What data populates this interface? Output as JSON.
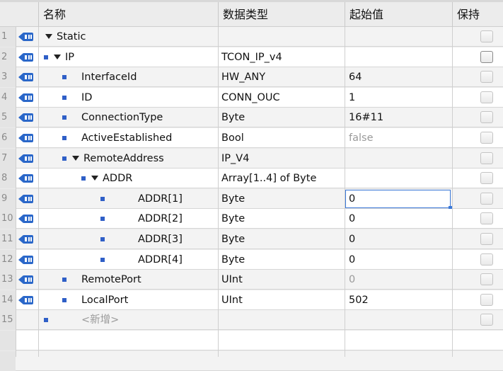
{
  "columns": {
    "name": "名称",
    "data_type": "数据类型",
    "start_value": "起始值",
    "retain": "保持"
  },
  "rows": [
    {
      "num": "1",
      "level": 0,
      "expander": true,
      "bullet": false,
      "name": "Static",
      "type": "",
      "value": "",
      "value_gray": false,
      "check_dark": false
    },
    {
      "num": "2",
      "level": 0,
      "expander": true,
      "bullet": true,
      "name": "IP",
      "type": "TCON_IP_v4",
      "value": "",
      "value_gray": false,
      "check_dark": true
    },
    {
      "num": "3",
      "level": 1,
      "expander": false,
      "bullet": true,
      "name": "InterfaceId",
      "type": "HW_ANY",
      "value": "64",
      "value_gray": false,
      "check_dark": false
    },
    {
      "num": "4",
      "level": 1,
      "expander": false,
      "bullet": true,
      "name": "ID",
      "type": "CONN_OUC",
      "value": "1",
      "value_gray": false,
      "check_dark": false
    },
    {
      "num": "5",
      "level": 1,
      "expander": false,
      "bullet": true,
      "name": "ConnectionType",
      "type": "Byte",
      "value": "16#11",
      "value_gray": false,
      "check_dark": false
    },
    {
      "num": "6",
      "level": 1,
      "expander": false,
      "bullet": true,
      "name": "ActiveEstablished",
      "type": "Bool",
      "value": "false",
      "value_gray": true,
      "check_dark": false
    },
    {
      "num": "7",
      "level": 1,
      "expander": true,
      "bullet": true,
      "name": "RemoteAddress",
      "type": "IP_V4",
      "value": "",
      "value_gray": false,
      "check_dark": false
    },
    {
      "num": "8",
      "level": 2,
      "expander": true,
      "bullet": true,
      "name": "ADDR",
      "type": "Array[1..4] of Byte",
      "value": "",
      "value_gray": false,
      "check_dark": false
    },
    {
      "num": "9",
      "level": 3,
      "expander": false,
      "bullet": true,
      "name": "ADDR[1]",
      "type": "Byte",
      "value": "0",
      "value_gray": false,
      "check_dark": false,
      "editing": true
    },
    {
      "num": "10",
      "level": 3,
      "expander": false,
      "bullet": true,
      "name": "ADDR[2]",
      "type": "Byte",
      "value": "0",
      "value_gray": false,
      "check_dark": false
    },
    {
      "num": "11",
      "level": 3,
      "expander": false,
      "bullet": true,
      "name": "ADDR[3]",
      "type": "Byte",
      "value": "0",
      "value_gray": false,
      "check_dark": false
    },
    {
      "num": "12",
      "level": 3,
      "expander": false,
      "bullet": true,
      "name": "ADDR[4]",
      "type": "Byte",
      "value": "0",
      "value_gray": false,
      "check_dark": false
    },
    {
      "num": "13",
      "level": 1,
      "expander": false,
      "bullet": true,
      "name": "RemotePort",
      "type": "UInt",
      "value": "0",
      "value_gray": true,
      "check_dark": false
    },
    {
      "num": "14",
      "level": 1,
      "expander": false,
      "bullet": true,
      "name": "LocalPort",
      "type": "UInt",
      "value": "502",
      "value_gray": false,
      "check_dark": false
    },
    {
      "num": "15",
      "level": 0,
      "expander": false,
      "bullet": true,
      "name": "<新增>",
      "type": "",
      "value": "",
      "value_gray": true,
      "check_dark": false,
      "add_row": true
    }
  ]
}
